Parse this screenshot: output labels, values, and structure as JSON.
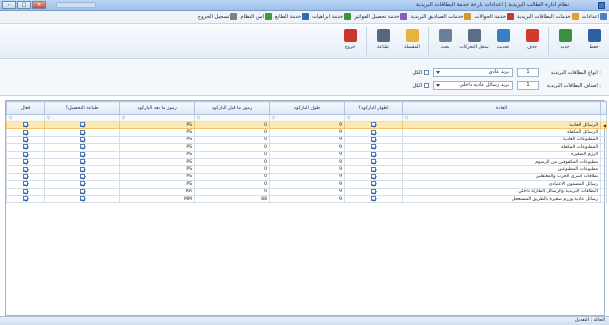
{
  "window": {
    "title": "نظام ادارة الطالب البريدية | اعدادات بارعة خدمة البطاقات البريدية",
    "controls": {
      "minimize": "–",
      "maximize": "□",
      "close": "✕"
    }
  },
  "menu": [
    {
      "label": "اعدادات",
      "icon": "settings-icon",
      "color": "#4b7fc2"
    },
    {
      "label": "خدمات البطاقات البريدية",
      "icon": "mail-icon",
      "color": "#e0a030"
    },
    {
      "label": "خدمة الحوالات",
      "icon": "transfer-icon",
      "color": "#c23b2b"
    },
    {
      "label": "خدمات الصناديق البريدية",
      "icon": "box-icon",
      "color": "#d59a26"
    },
    {
      "label": "خدمة تحصيل الفواتير",
      "icon": "bill-icon",
      "color": "#8a5bb8"
    },
    {
      "label": "خدمة ابراهيات",
      "icon": "dollar-icon",
      "color": "#3f8f3f"
    },
    {
      "label": "خدمة الطابع",
      "icon": "stamp-icon",
      "color": "#2d6eb5"
    },
    {
      "label": "امن النظام",
      "icon": "shield-icon",
      "color": "#3b9b3b"
    },
    {
      "label": "تسجيل الخروج",
      "icon": "logout-icon",
      "color": "#7f7f7f"
    }
  ],
  "toolbar": [
    {
      "label": "حفظ",
      "icon": "save-icon",
      "color": "#2f5f9f"
    },
    {
      "label": "جديد",
      "icon": "new-icon",
      "color": "#3d8f3d"
    },
    {
      "label": "حذف",
      "icon": "delete-icon",
      "color": "#d33a2c"
    },
    {
      "label": "تحديث",
      "icon": "refresh-icon",
      "color": "#3a7fc6"
    },
    {
      "label": "سجل التحركات",
      "icon": "history-icon",
      "color": "#5a6e8a"
    },
    {
      "label": "بحث",
      "icon": "search-icon",
      "color": "#6a7f99"
    },
    {
      "label": "المفضلة",
      "icon": "star-icon",
      "color": "#e9b23a"
    },
    {
      "label": "طباعة",
      "icon": "print-icon",
      "color": "#56677d"
    },
    {
      "label": "خروج",
      "icon": "exit-icon",
      "color": "#c7352b"
    }
  ],
  "filters": {
    "row1": {
      "label": "انواع البطاقات البريدية :",
      "code": "1",
      "value": "بريد عادي",
      "check_label": "الكل"
    },
    "row2": {
      "label": "اصناف البطاقات البريدية :",
      "code": "1",
      "value": "بريد رسائل عادية داخلي",
      "check_label": "الكل"
    }
  },
  "grid": {
    "columns": [
      "العادة",
      "اظهار الباركود؟",
      "طول الباركود",
      "رموز ما قبل الباركود",
      "رموز ما بعد الباركود",
      "طباعة التحصيل؟",
      "فعال"
    ],
    "rows": [
      {
        "name": "الرسائل العادية",
        "show_barcode": true,
        "length": "9",
        "prefix": "0",
        "suffix": "PS",
        "print": true,
        "active": true
      },
      {
        "name": "الرسائل المكفلة",
        "show_barcode": true,
        "length": "9",
        "prefix": "0",
        "suffix": "PS",
        "print": true,
        "active": true
      },
      {
        "name": "المطبوعات العادية",
        "show_barcode": true,
        "length": "9",
        "prefix": "0",
        "suffix": "PS",
        "print": true,
        "active": true
      },
      {
        "name": "المطبوعات المكفلة",
        "show_barcode": true,
        "length": "9",
        "prefix": "0",
        "suffix": "PS",
        "print": true,
        "active": true
      },
      {
        "name": "الرزم الصغيرة",
        "show_barcode": true,
        "length": "9",
        "prefix": "0",
        "suffix": "PS",
        "print": true,
        "active": true
      },
      {
        "name": "مطبوعات المكفوفين من الرسوم",
        "show_barcode": true,
        "length": "9",
        "prefix": "0",
        "suffix": "PS",
        "print": true,
        "active": true
      },
      {
        "name": "مطبوعات المطبوعين",
        "show_barcode": true,
        "length": "9",
        "prefix": "0",
        "suffix": "PS",
        "print": true,
        "active": true
      },
      {
        "name": "بطاقات أسرى الحرب والمعتقلين",
        "show_barcode": true,
        "length": "9",
        "prefix": "0",
        "suffix": "PS",
        "print": true,
        "active": true
      },
      {
        "name": "رسائل المضمون الاعتيادي",
        "show_barcode": true,
        "length": "9",
        "prefix": "0",
        "suffix": "PS",
        "print": true,
        "active": true
      },
      {
        "name": "البطاقات البريدية والرسائل الطارئة داخلي",
        "show_barcode": true,
        "length": "9",
        "prefix": "0",
        "suffix": "RR",
        "print": true,
        "active": true
      },
      {
        "name": "رسائل عادية وزرم صغيرة بالطريق المستعجل",
        "show_barcode": true,
        "length": "9",
        "prefix": "88",
        "suffix": "MM",
        "print": true,
        "active": true
      }
    ]
  },
  "status": {
    "text": "الحالة : التعديل"
  }
}
